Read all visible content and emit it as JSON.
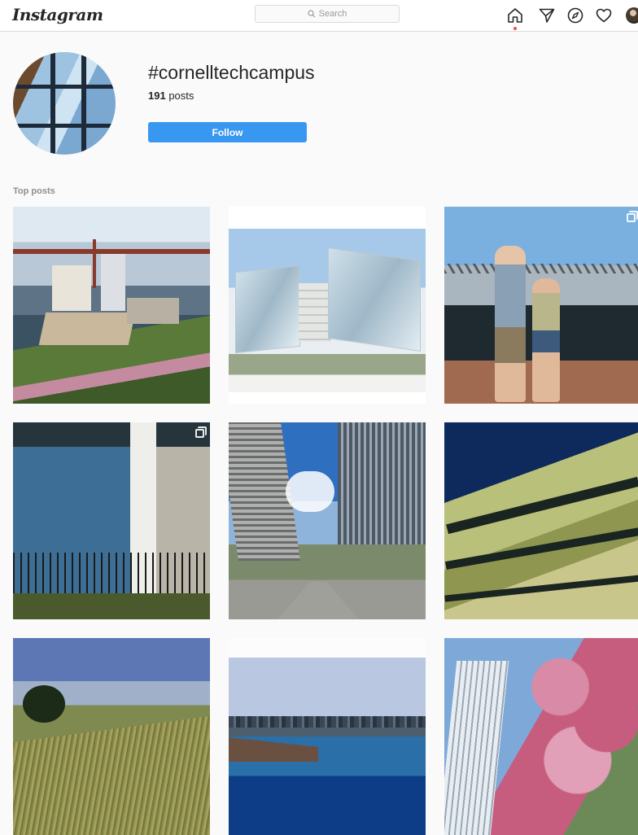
{
  "nav": {
    "logo": "Instagram",
    "search_placeholder": "Search",
    "icons": [
      "home-icon",
      "direct-icon",
      "explore-icon",
      "heart-icon",
      "profile-avatar"
    ]
  },
  "header": {
    "hashtag": "#cornelltechcampus",
    "posts_count": "191",
    "posts_label": "posts",
    "follow_label": "Follow"
  },
  "top_posts": {
    "label": "Top posts",
    "tiles": [
      {
        "id": 1,
        "subject": "aerial rendering of campus and bridge",
        "multi": false
      },
      {
        "id": 2,
        "subject": "glass buildings rendering",
        "multi": false
      },
      {
        "id": 3,
        "subject": "couple by bridge",
        "multi": true
      },
      {
        "id": 4,
        "subject": "glass atrium building",
        "multi": true
      },
      {
        "id": 5,
        "subject": "walkway between towers",
        "multi": false
      },
      {
        "id": 6,
        "subject": "metallic facade",
        "multi": false
      },
      {
        "id": 7,
        "subject": "grassy hill",
        "multi": false
      },
      {
        "id": 8,
        "subject": "river and skyline",
        "multi": false
      },
      {
        "id": 9,
        "subject": "tower and cherry blossoms",
        "multi": false
      }
    ]
  },
  "colors": {
    "follow_button": "#3897f0",
    "notification_dot": "#ed4956",
    "background": "#fafafa"
  }
}
